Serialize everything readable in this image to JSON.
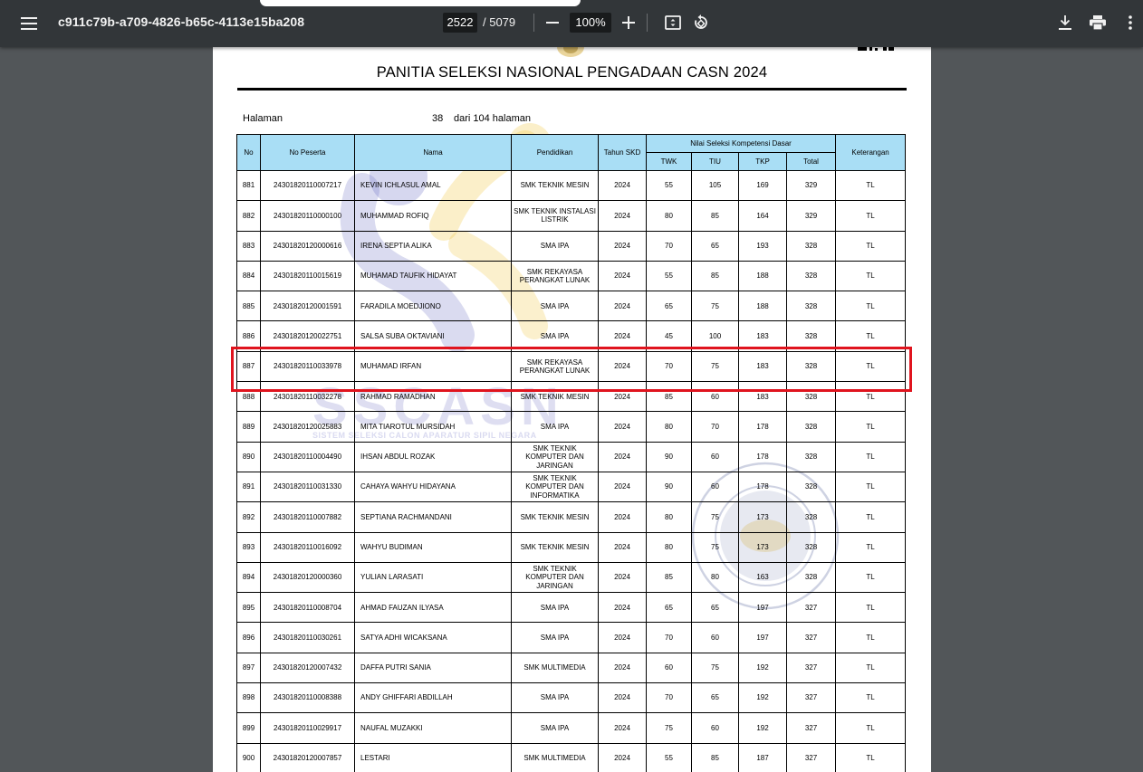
{
  "toolbar": {
    "doc_title": "c911c79b-a709-4826-b65c-4113e15ba208",
    "current_page": "2522",
    "page_total": "/ 5079",
    "zoom": "100%"
  },
  "document": {
    "heading": "PANITIA SELEKSI NASIONAL PENGADAAN CASN 2024",
    "halaman_label": "Halaman",
    "halaman_number": "38",
    "halaman_of": "dari 104 halaman",
    "columns": {
      "no": "No",
      "no_peserta": "No Peserta",
      "nama": "Nama",
      "pendidikan": "Pendidikan",
      "tahun_skd": "Tahun SKD",
      "nilai_group": "Nilai Seleksi Kompetensi Dasar",
      "twk": "TWK",
      "tiu": "TIU",
      "tkp": "TKP",
      "total": "Total",
      "keterangan": "Keterangan"
    },
    "rows": [
      {
        "no": "881",
        "peserta": "24301820110007217",
        "nama": "KEVIN ICHLASUL AMAL",
        "pendidikan": "SMK TEKNIK MESIN",
        "tahun": "2024",
        "twk": "55",
        "tiu": "105",
        "tkp": "169",
        "total": "329",
        "ket": "TL"
      },
      {
        "no": "882",
        "peserta": "24301820110000100",
        "nama": "MUHAMMAD ROFIQ",
        "pendidikan": "SMK TEKNIK INSTALASI LISTRIK",
        "tahun": "2024",
        "twk": "80",
        "tiu": "85",
        "tkp": "164",
        "total": "329",
        "ket": "TL"
      },
      {
        "no": "883",
        "peserta": "24301820120000616",
        "nama": "IRENA SEPTIA ALIKA",
        "pendidikan": "SMA IPA",
        "tahun": "2024",
        "twk": "70",
        "tiu": "65",
        "tkp": "193",
        "total": "328",
        "ket": "TL"
      },
      {
        "no": "884",
        "peserta": "24301820110015619",
        "nama": "MUHAMAD TAUFIK HIDAYAT",
        "pendidikan": "SMK REKAYASA PERANGKAT LUNAK",
        "tahun": "2024",
        "twk": "55",
        "tiu": "85",
        "tkp": "188",
        "total": "328",
        "ket": "TL"
      },
      {
        "no": "885",
        "peserta": "24301820120001591",
        "nama": "FARADILA MOEDJIONO",
        "pendidikan": "SMA IPA",
        "tahun": "2024",
        "twk": "65",
        "tiu": "75",
        "tkp": "188",
        "total": "328",
        "ket": "TL"
      },
      {
        "no": "886",
        "peserta": "24301820120022751",
        "nama": "SALSA SUBA OKTAVIANI",
        "pendidikan": "SMA IPA",
        "tahun": "2024",
        "twk": "45",
        "tiu": "100",
        "tkp": "183",
        "total": "328",
        "ket": "TL"
      },
      {
        "no": "887",
        "peserta": "24301820110033978",
        "nama": "MUHAMAD IRFAN",
        "pendidikan": "SMK REKAYASA PERANGKAT LUNAK",
        "tahun": "2024",
        "twk": "70",
        "tiu": "75",
        "tkp": "183",
        "total": "328",
        "ket": "TL"
      },
      {
        "no": "888",
        "peserta": "24301820110032278",
        "nama": "RAHMAD RAMADHAN",
        "pendidikan": "SMK TEKNIK MESIN",
        "tahun": "2024",
        "twk": "85",
        "tiu": "60",
        "tkp": "183",
        "total": "328",
        "ket": "TL"
      },
      {
        "no": "889",
        "peserta": "24301820120025883",
        "nama": "MITA TIAROTUL MURSIDAH",
        "pendidikan": "SMA IPA",
        "tahun": "2024",
        "twk": "80",
        "tiu": "70",
        "tkp": "178",
        "total": "328",
        "ket": "TL"
      },
      {
        "no": "890",
        "peserta": "24301820110004490",
        "nama": "IHSAN ABDUL ROZAK",
        "pendidikan": "SMK TEKNIK KOMPUTER DAN JARINGAN",
        "tahun": "2024",
        "twk": "90",
        "tiu": "60",
        "tkp": "178",
        "total": "328",
        "ket": "TL"
      },
      {
        "no": "891",
        "peserta": "24301820110031330",
        "nama": "CAHAYA WAHYU HIDAYANA",
        "pendidikan": "SMK TEKNIK KOMPUTER DAN INFORMATIKA",
        "tahun": "2024",
        "twk": "90",
        "tiu": "60",
        "tkp": "178",
        "total": "328",
        "ket": "TL"
      },
      {
        "no": "892",
        "peserta": "24301820110007882",
        "nama": "SEPTIANA RACHMANDANI",
        "pendidikan": "SMK TEKNIK MESIN",
        "tahun": "2024",
        "twk": "80",
        "tiu": "75",
        "tkp": "173",
        "total": "328",
        "ket": "TL"
      },
      {
        "no": "893",
        "peserta": "24301820110016092",
        "nama": "WAHYU BUDIMAN",
        "pendidikan": "SMK TEKNIK MESIN",
        "tahun": "2024",
        "twk": "80",
        "tiu": "75",
        "tkp": "173",
        "total": "328",
        "ket": "TL"
      },
      {
        "no": "894",
        "peserta": "24301820120000360",
        "nama": "YULIAN LARASATI",
        "pendidikan": "SMK TEKNIK KOMPUTER DAN JARINGAN",
        "tahun": "2024",
        "twk": "85",
        "tiu": "80",
        "tkp": "163",
        "total": "328",
        "ket": "TL"
      },
      {
        "no": "895",
        "peserta": "24301820110008704",
        "nama": "AHMAD FAUZAN ILYASA",
        "pendidikan": "SMA IPA",
        "tahun": "2024",
        "twk": "65",
        "tiu": "65",
        "tkp": "197",
        "total": "327",
        "ket": "TL"
      },
      {
        "no": "896",
        "peserta": "24301820110030261",
        "nama": "SATYA ADHI WICAKSANA",
        "pendidikan": "SMA IPA",
        "tahun": "2024",
        "twk": "70",
        "tiu": "60",
        "tkp": "197",
        "total": "327",
        "ket": "TL"
      },
      {
        "no": "897",
        "peserta": "24301820120007432",
        "nama": "DAFFA PUTRI SANIA",
        "pendidikan": "SMK MULTIMEDIA",
        "tahun": "2024",
        "twk": "60",
        "tiu": "75",
        "tkp": "192",
        "total": "327",
        "ket": "TL"
      },
      {
        "no": "898",
        "peserta": "24301820110008388",
        "nama": "ANDY GHIFFARI ABDILLAH",
        "pendidikan": "SMA IPA",
        "tahun": "2024",
        "twk": "70",
        "tiu": "65",
        "tkp": "192",
        "total": "327",
        "ket": "TL"
      },
      {
        "no": "899",
        "peserta": "24301820110029917",
        "nama": "NAUFAL MUZAKKI",
        "pendidikan": "SMA IPA",
        "tahun": "2024",
        "twk": "75",
        "tiu": "60",
        "tkp": "192",
        "total": "327",
        "ket": "TL"
      },
      {
        "no": "900",
        "peserta": "24301820120007857",
        "nama": "LESTARI",
        "pendidikan": "SMK MULTIMEDIA",
        "tahun": "2024",
        "twk": "55",
        "tiu": "85",
        "tkp": "187",
        "total": "327",
        "ket": "TL"
      }
    ],
    "highlighted_row": "887",
    "watermark_text": "SSCASN",
    "watermark_subtext": "SISTEM SELEKSI CALON APARATUR SIPIL NEGARA",
    "stamp_text": "COMPUTER ASSISTED TEST · BADAN KEPEGAWAIAN NEGARA"
  },
  "colors": {
    "toolbar_bg": "#323639",
    "viewer_bg": "#525659",
    "header_fill": "#a9def5",
    "highlight": "#e0141e"
  },
  "icons": [
    "menu-icon",
    "zoom-out-icon",
    "zoom-in-icon",
    "fit-page-icon",
    "rotate-icon",
    "download-icon",
    "print-icon",
    "more-vert-icon"
  ]
}
